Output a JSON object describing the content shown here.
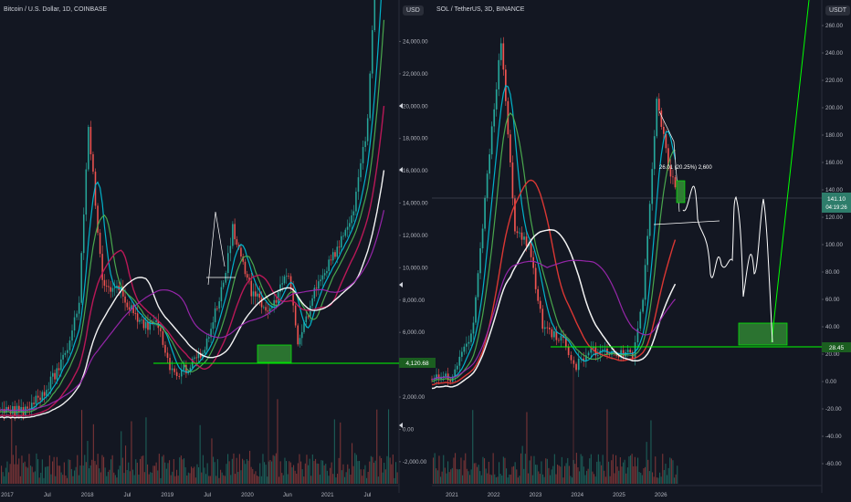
{
  "panels": {
    "left": {
      "title": "Bitcoin / U.S. Dollar, 1D, COINBASE",
      "unit": "USD"
    },
    "right": {
      "title": "SOL / TetherUS, 3D, BINANCE",
      "unit": "USDT"
    }
  },
  "colors": {
    "background": "#131722",
    "candle_up": "#26a69a",
    "candle_down": "#ef5350",
    "volume_up": "#1f6b62",
    "volume_down": "#8c3a3a",
    "ma_white": "#ffffff",
    "ma_cyan": "#00bcd4",
    "ma_green": "#4caf50",
    "ma_magenta": "#c2185b",
    "ma_purple": "#9c27b0",
    "ma_red": "#e53935",
    "annotation_green": "#00ff00",
    "box_fill": "#2e7d32",
    "price_tag": "#1b5e20",
    "current_price_tag": "#2e7d6b"
  },
  "chart_data": [
    {
      "type": "line",
      "name": "Bitcoin / U.S. Dollar, 1D, COINBASE",
      "yaxis_ticks": [
        "24,000.00",
        "22,000.00",
        "20,000.00",
        "18,000.00",
        "16,000.00",
        "14,000.00",
        "12,000.00",
        "10,000.00",
        "8,000.00",
        "6,000.00",
        "4,000.00",
        "2,000.00",
        "0.00",
        "-2,000.00"
      ],
      "xaxis_ticks": [
        "2017",
        "Jul",
        "2018",
        "Jul",
        "2019",
        "Jul",
        "2020",
        "Jun",
        "2021",
        "Jul"
      ],
      "ylim": [
        -2800,
        26000
      ],
      "x": [
        2017.0,
        2017.25,
        2017.5,
        2017.7,
        2017.85,
        2017.95,
        2018.1,
        2018.3,
        2018.5,
        2018.7,
        2018.85,
        2019.0,
        2019.2,
        2019.4,
        2019.5,
        2019.7,
        2019.9,
        2020.1,
        2020.2,
        2020.4,
        2020.6,
        2020.8,
        2020.95,
        2021.05,
        2021.15
      ],
      "price": [
        1000,
        1200,
        2500,
        4500,
        8000,
        19000,
        9000,
        8500,
        6500,
        6400,
        3500,
        3700,
        5000,
        9000,
        12500,
        8500,
        7200,
        9800,
        5000,
        9000,
        11000,
        13500,
        19000,
        30000,
        40000
      ],
      "annotations": {
        "price_tag": "4,120.68"
      }
    },
    {
      "type": "line",
      "name": "SOL / TetherUS, 3D, BINANCE",
      "yaxis_ticks": [
        "260.00",
        "240.00",
        "220.00",
        "200.00",
        "180.00",
        "160.00",
        "140.00",
        "120.00",
        "100.00",
        "80.00",
        "60.00",
        "40.00",
        "20.00",
        "0.00",
        "-20.00",
        "-40.00",
        "-60.00"
      ],
      "xaxis_ticks": [
        "2021",
        "2022",
        "2023",
        "2024",
        "2025",
        "2026"
      ],
      "ylim": [
        -68,
        272
      ],
      "x": [
        2020.9,
        2021.2,
        2021.5,
        2021.7,
        2021.9,
        2022.1,
        2022.3,
        2022.5,
        2022.8,
        2022.95,
        2023.2,
        2023.5,
        2023.8,
        2023.95,
        2024.15,
        2024.35,
        2024.45
      ],
      "price": [
        1.5,
        3,
        40,
        150,
        250,
        110,
        100,
        40,
        30,
        10,
        22,
        20,
        20,
        60,
        205,
        150,
        140
      ],
      "annotations": {
        "current_price": "141.10",
        "countdown": "04:19:26",
        "support_tag": "28.45",
        "measure_label": "26.01 (20.25%) 2,600"
      }
    }
  ]
}
